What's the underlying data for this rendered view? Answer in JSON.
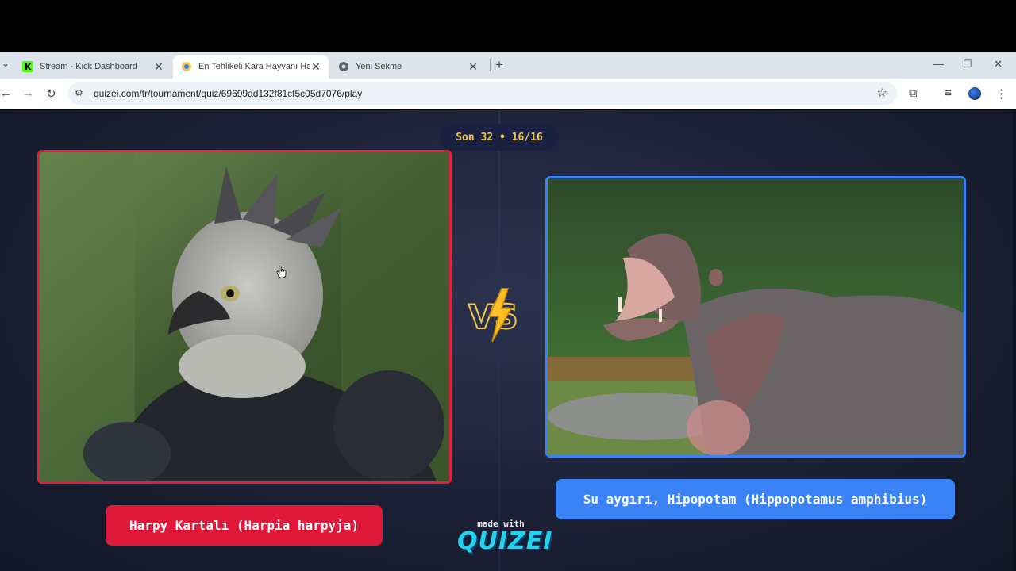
{
  "browser": {
    "tabs": [
      {
        "title": "Stream - Kick Dashboard",
        "favicon": "kick-icon",
        "active": false
      },
      {
        "title": "En Tehlikeli Kara Hayvanı Hangi",
        "favicon": "quizei-icon",
        "active": true
      },
      {
        "title": "Yeni Sekme",
        "favicon": "chrome-icon",
        "active": false
      }
    ],
    "url": "quizei.com/tr/tournament/quiz/69699ad132f81cf5c05d7076/play"
  },
  "round": "Son 32 • 16/16",
  "left": {
    "label": "Harpy Kartalı (Harpia harpyja)",
    "accent": "#e0183a"
  },
  "right": {
    "label": "Su aygırı, Hipopotam (Hippopotamus amphibius)",
    "accent": "#3b82f6"
  },
  "vs": "VS",
  "footer": {
    "made_with": "made with",
    "brand": "QUIZEI"
  }
}
